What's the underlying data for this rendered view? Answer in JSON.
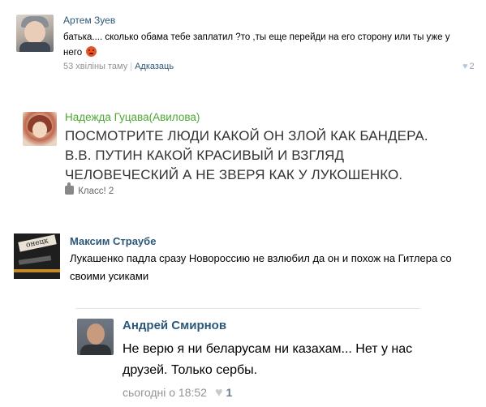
{
  "comments": [
    {
      "author": "Артем Зуев",
      "text": "батька.... сколько обама тебе заплатил ?то ,ты еще перейди на его сторону или ты уже у него",
      "emoji_icon": "angry-face-icon",
      "time": "53 хвіліны таму",
      "reply_label": "Адказаць",
      "likes": "2"
    },
    {
      "author": "Надежда Гуцава(Авилова)",
      "text": "ПОСМОТРИТЕ ЛЮДИ КАКОЙ ОН ЗЛОЙ КАК БАНДЕРА. В.В. ПУТИН КАКОЙ КРАСИВЫЙ И ВЗГЛЯД ЧЕЛОВЕЧЕСКИЙ А НЕ ЗВЕРЯ КАК У ЛУКОШЕНКО.",
      "likes_label": "Класс! 2"
    },
    {
      "author": "Максим Страубе",
      "text": "Лукашенко падла сразу Новороссию не взлюбил да он и похож на Гитлера со своими усиками",
      "avatar_text": "онецк"
    },
    {
      "author": "Андрей Смирнов",
      "text": "Не верю я ни беларусам ни казахам... Нет у нас друзей. Только сербы.",
      "time": "сьогодні о 18:52",
      "likes": "1"
    }
  ],
  "colors": {
    "link": "#2b587a",
    "ok_green": "#4ea733",
    "meta_gray": "#939393"
  }
}
